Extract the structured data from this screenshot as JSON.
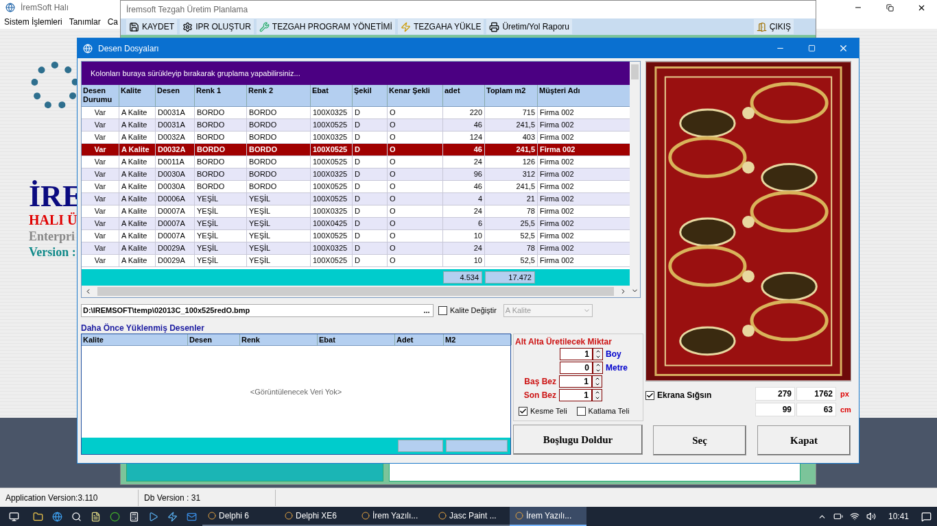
{
  "main_window": {
    "title": "İremSoft Halı",
    "menu": [
      "Sistem İşlemleri",
      "Tanımlar",
      "Ca"
    ],
    "splash": [
      {
        "text": "İRE",
        "kind": "brand"
      },
      {
        "text": "HALI Ü",
        "kind": "subtitle"
      },
      {
        "text": "Enterpri",
        "kind": "edition"
      },
      {
        "text": "Version :",
        "kind": "version"
      }
    ]
  },
  "planning_window": {
    "title": "İremsoft Tezgah Üretim Planlama",
    "toolbar": [
      {
        "label": "KAYDET",
        "kind": "save"
      },
      {
        "label": "IPR OLUŞTUR",
        "kind": "gear"
      },
      {
        "label": "TEZGAH PROGRAM YÖNETİMİ",
        "kind": "tool"
      },
      {
        "label": "TEZGAHA YÜKLE",
        "kind": "load"
      },
      {
        "label": "Üretim/Yol Raporu",
        "kind": "report"
      }
    ],
    "exit_button": "ÇIKIŞ"
  },
  "dialog": {
    "title": "Desen Dosyaları",
    "group_panel": "Kolonları buraya sürükleyip bırakarak gruplama yapabilirsiniz...",
    "grid": {
      "columns": [
        {
          "label": "Desen Durumu",
          "kind": "status"
        },
        {
          "label": "Kalite",
          "kind": "text"
        },
        {
          "label": "Desen",
          "kind": "text"
        },
        {
          "label": "Renk 1",
          "kind": "text"
        },
        {
          "label": "Renk 2",
          "kind": "text"
        },
        {
          "label": "Ebat",
          "kind": "text"
        },
        {
          "label": "Şekil",
          "kind": "text"
        },
        {
          "label": "Kenar Şekli",
          "kind": "text"
        },
        {
          "label": "adet",
          "kind": "number"
        },
        {
          "label": "Toplam m2",
          "kind": "number"
        },
        {
          "label": "Müşteri Adı",
          "kind": "text"
        }
      ],
      "rows": [
        {
          "cells": [
            "Var",
            "A Kalite",
            "D0031A",
            "BORDO",
            "BORDO",
            "100X0325",
            "D",
            "O",
            "220",
            "715",
            "Firma 002"
          ],
          "selected": false
        },
        {
          "cells": [
            "Var",
            "A Kalite",
            "D0031A",
            "BORDO",
            "BORDO",
            "100X0525",
            "D",
            "O",
            "46",
            "241,5",
            "Firma 002"
          ],
          "selected": false
        },
        {
          "cells": [
            "Var",
            "A Kalite",
            "D0032A",
            "BORDO",
            "BORDO",
            "100X0325",
            "D",
            "O",
            "124",
            "403",
            "Firma 002"
          ],
          "selected": false
        },
        {
          "cells": [
            "Var",
            "A Kalite",
            "D0032A",
            "BORDO",
            "BORDO",
            "100X0525",
            "D",
            "O",
            "46",
            "241,5",
            "Firma 002"
          ],
          "selected": true
        },
        {
          "cells": [
            "Var",
            "A Kalite",
            "D0011A",
            "BORDO",
            "BORDO",
            "100X0525",
            "D",
            "O",
            "24",
            "126",
            "Firma 002"
          ],
          "selected": false
        },
        {
          "cells": [
            "Var",
            "A Kalite",
            "D0030A",
            "BORDO",
            "BORDO",
            "100X0325",
            "D",
            "O",
            "96",
            "312",
            "Firma 002"
          ],
          "selected": false
        },
        {
          "cells": [
            "Var",
            "A Kalite",
            "D0030A",
            "BORDO",
            "BORDO",
            "100X0525",
            "D",
            "O",
            "46",
            "241,5",
            "Firma 002"
          ],
          "selected": false
        },
        {
          "cells": [
            "Var",
            "A Kalite",
            "D0006A",
            "YEŞİL",
            "YEŞİL",
            "100X0525",
            "D",
            "O",
            "4",
            "21",
            "Firma 002"
          ],
          "selected": false
        },
        {
          "cells": [
            "Var",
            "A Kalite",
            "D0007A",
            "YEŞİL",
            "YEŞİL",
            "100X0325",
            "D",
            "O",
            "24",
            "78",
            "Firma 002"
          ],
          "selected": false
        },
        {
          "cells": [
            "Var",
            "A Kalite",
            "D0007A",
            "YEŞİL",
            "YEŞİL",
            "100X0425",
            "D",
            "O",
            "6",
            "25,5",
            "Firma 002"
          ],
          "selected": false
        },
        {
          "cells": [
            "Var",
            "A Kalite",
            "D0007A",
            "YEŞİL",
            "YEŞİL",
            "100X0525",
            "D",
            "O",
            "10",
            "52,5",
            "Firma 002"
          ],
          "selected": false
        },
        {
          "cells": [
            "Var",
            "A Kalite",
            "D0029A",
            "YEŞİL",
            "YEŞİL",
            "100X0325",
            "D",
            "O",
            "24",
            "78",
            "Firma 002"
          ],
          "selected": false
        },
        {
          "cells": [
            "Var",
            "A Kalite",
            "D0029A",
            "YEŞİL",
            "YEŞİL",
            "100X0525",
            "D",
            "O",
            "10",
            "52,5",
            "Firma 002"
          ],
          "selected": false
        }
      ],
      "totals": [
        "4.534",
        "17.472"
      ]
    },
    "file_path": "D:\\IREMSOFT\\temp\\02013C_100x525redO.bmp",
    "browse_button": "...",
    "quality_change": {
      "label": "Kalite Değiştir",
      "checked": false
    },
    "quality_combo": {
      "value": "A Kalite",
      "disabled": true
    },
    "loaded_title": "Daha Önce Yüklenmiş Desenler",
    "loaded_grid": {
      "columns": [
        "Kalite",
        "Desen",
        "Renk",
        "Ebat",
        "Adet",
        "M2"
      ],
      "empty_text": "<Görüntülenecek Veri Yok>"
    },
    "quantity_panel": {
      "title": "Alt Alta Üretilecek Miktar",
      "spinners": [
        {
          "label": "Boy",
          "value": "1",
          "kind": "unit"
        },
        {
          "label": "Metre",
          "value": "0",
          "kind": "unit"
        },
        {
          "label": "Baş Bez",
          "value": "1",
          "kind": "count"
        },
        {
          "label": "Son Bez",
          "value": "1",
          "kind": "count"
        }
      ],
      "checkboxes": [
        {
          "label": "Kesme Teli",
          "checked": true
        },
        {
          "label": "Katlama Teli",
          "checked": false
        }
      ]
    },
    "fit_screen": {
      "label": "Ekrana Sığsın",
      "checked": true
    },
    "sizes": [
      {
        "values": [
          "279",
          "1762"
        ],
        "unit": "px"
      },
      {
        "values": [
          "99",
          "63"
        ],
        "unit": "cm"
      }
    ],
    "buttons": [
      "Boşlugu Doldur",
      "Seç",
      "Kapat"
    ]
  },
  "status_bar": [
    "Application Version:3.110",
    "Db Version : 31"
  ],
  "taskbar": {
    "apps": [
      {
        "label": "Delphi 6",
        "selected": false
      },
      {
        "label": "Delphi XE6",
        "selected": false
      },
      {
        "label": "İrem Yazılı...",
        "selected": false
      },
      {
        "label": "Jasc Paint ...",
        "selected": false
      },
      {
        "label": "İrem Yazılı...",
        "selected": true
      }
    ],
    "clock": "10:41"
  }
}
